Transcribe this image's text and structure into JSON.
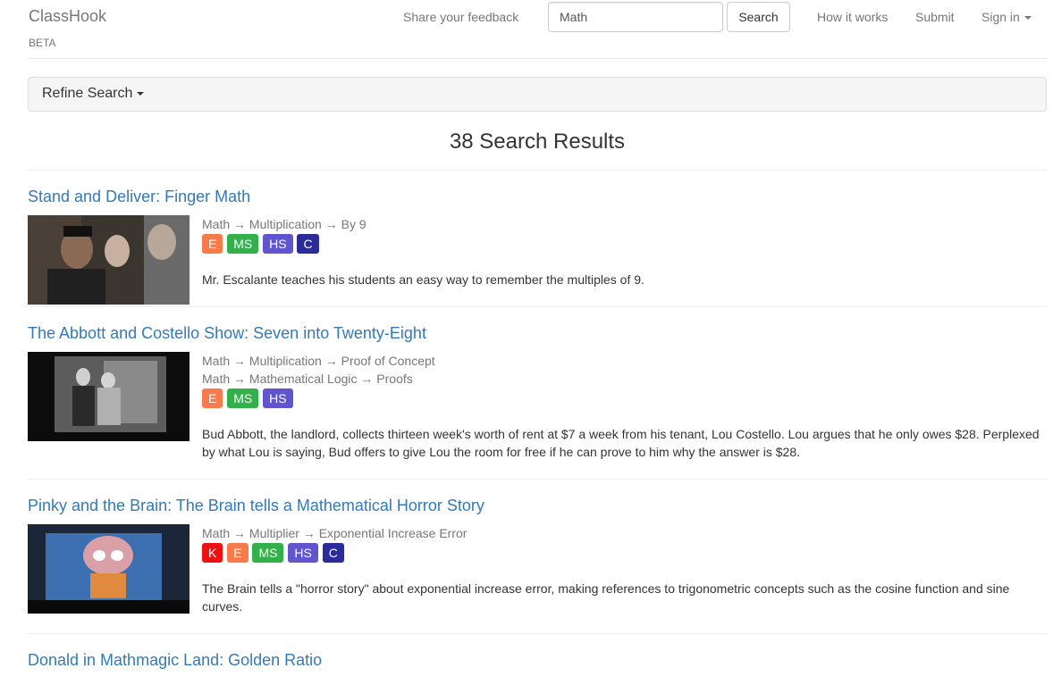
{
  "nav": {
    "brand": "ClassHook",
    "beta": "BETA",
    "feedback": "Share your feedback",
    "search_value": "Math",
    "search_button": "Search",
    "how_it_works": "How it works",
    "submit": "Submit",
    "sign_in": "Sign in"
  },
  "refine": {
    "label": "Refine Search"
  },
  "results": {
    "count_label": "38 Search Results",
    "items": [
      {
        "title": "Stand and Deliver: Finger Math",
        "subjects": [
          "Math → Multiplication → By 9"
        ],
        "badges": [
          "E",
          "MS",
          "HS",
          "C"
        ],
        "description": "Mr. Escalante teaches his students an easy way to remember the multiples of 9."
      },
      {
        "title": "The Abbott and Costello Show: Seven into Twenty-Eight",
        "subjects": [
          "Math → Multiplication → Proof of Concept",
          "Math → Mathematical Logic → Proofs"
        ],
        "badges": [
          "E",
          "MS",
          "HS"
        ],
        "description": "Bud Abbott, the landlord, collects thirteen week's worth of rent at $7 a week from his tenant, Lou Costello. Lou argues that he only owes $28. Perplexed by what Lou is saying, Bud offers to give Lou the room for free if he can prove to him why the answer is $28."
      },
      {
        "title": "Pinky and the Brain: The Brain tells a Mathematical Horror Story",
        "subjects": [
          "Math → Multiplier → Exponential Increase Error"
        ],
        "badges": [
          "K",
          "E",
          "MS",
          "HS",
          "C"
        ],
        "description": "The Brain tells a \"horror story\" about exponential increase error, making references to trigonometric concepts such as the cosine function and sine curves."
      },
      {
        "title": "Donald in Mathmagic Land: Golden Ratio",
        "subjects": [],
        "badges": [],
        "description": ""
      }
    ]
  }
}
